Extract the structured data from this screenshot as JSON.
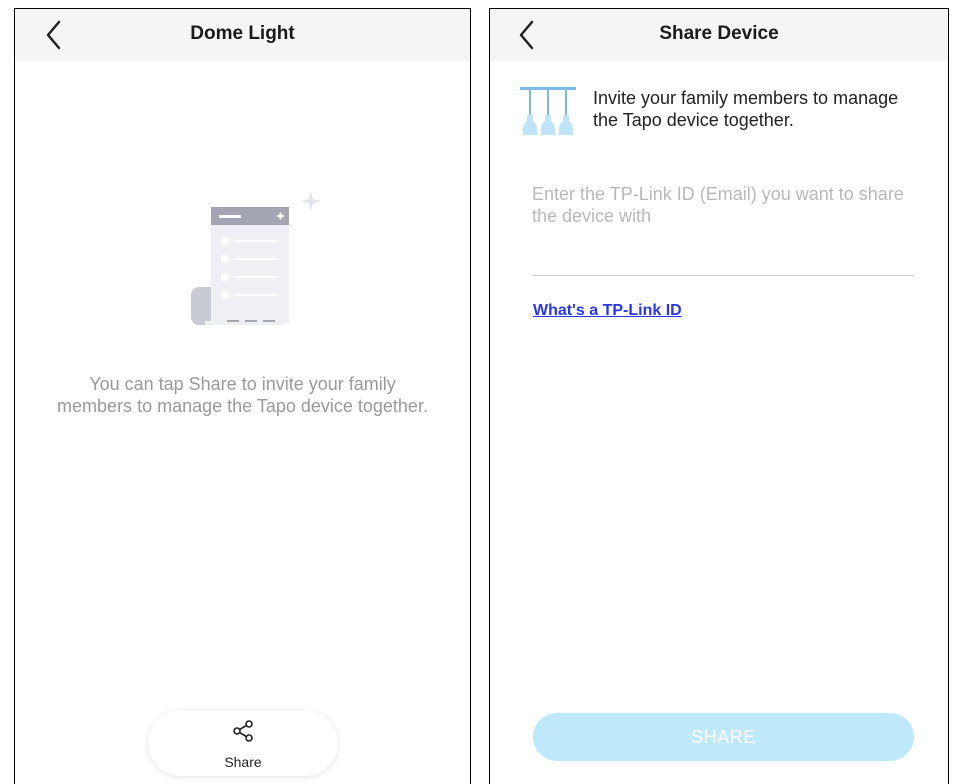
{
  "left_screen": {
    "title": "Dome Light",
    "empty_message": "You can tap Share to invite your family members to manage the Tapo device together.",
    "share_label": "Share"
  },
  "right_screen": {
    "title": "Share Device",
    "invite_text": "Invite your family members to manage the Tapo device together.",
    "email_placeholder": "Enter the TP-Link ID (Email) you want to share the device with",
    "email_value": "",
    "link_text": "What's a TP-Link ID",
    "share_button_label": "SHARE"
  },
  "icons": {
    "back": "chevron-left-icon",
    "share": "share-icon",
    "illustration": "list-document-illustration",
    "invite": "pendant-lights-icon"
  },
  "colors": {
    "header_bg": "#f5f5f5",
    "link": "#2a36e8",
    "share_button_disabled": "#bfe9fb",
    "illustration_gray": "#c9cbd4",
    "light_blue": "#7db9e4"
  }
}
